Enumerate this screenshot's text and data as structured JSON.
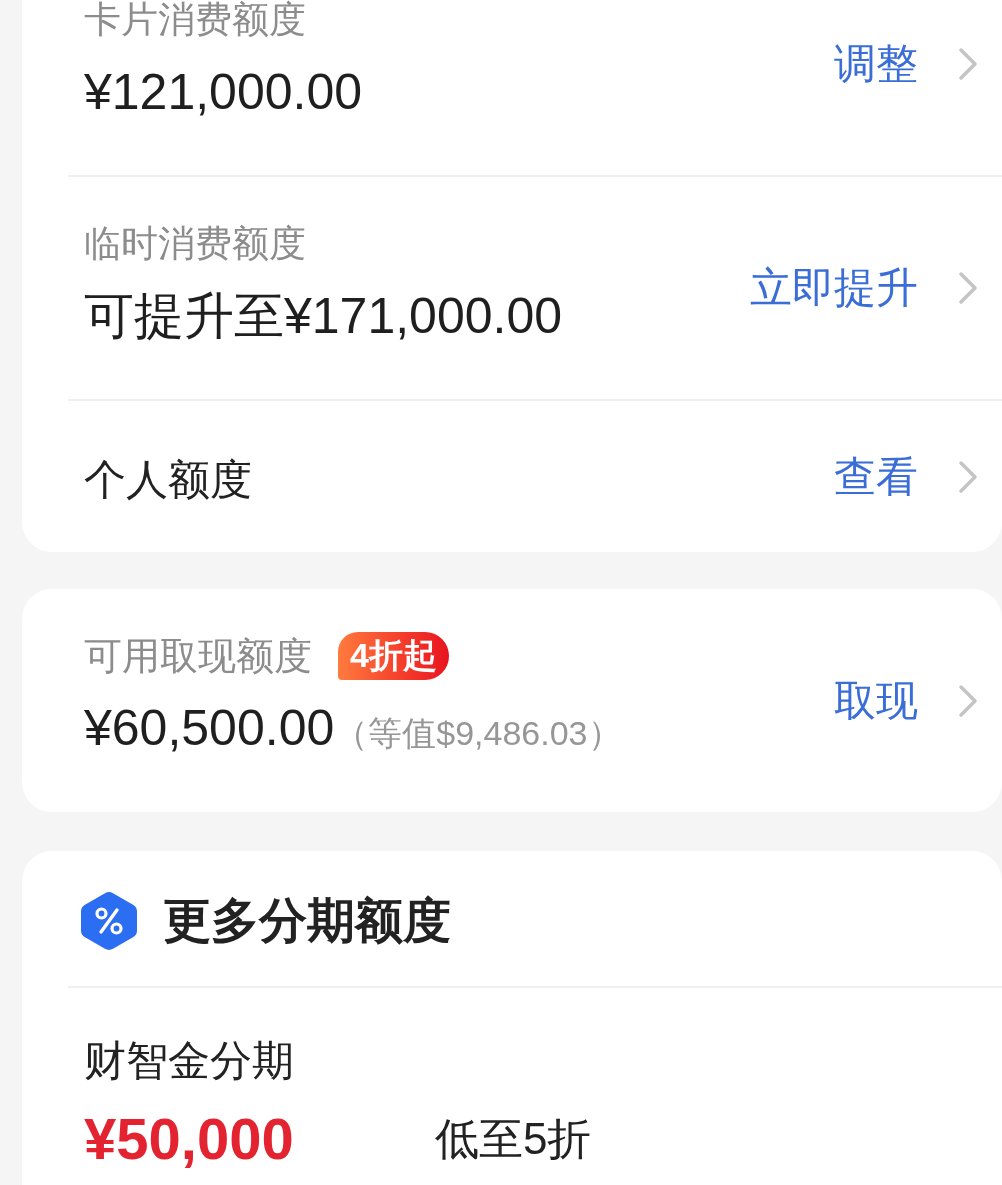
{
  "limit_card": {
    "rows": [
      {
        "kind": "amount",
        "label": "卡片消费额度",
        "value": "¥121,000.00",
        "action": "调整"
      },
      {
        "kind": "amount",
        "label": "临时消费额度",
        "value": "可提升至¥171,000.00",
        "action": "立即提升"
      },
      {
        "kind": "link",
        "label": "个人额度",
        "action": "查看"
      }
    ]
  },
  "cash_card": {
    "label": "可用取现额度",
    "badge": "4折起",
    "value": "¥60,500.00",
    "note": "（等值$9,486.03）",
    "action": "取现"
  },
  "installment_card": {
    "title": "更多分期额度",
    "items": [
      {
        "name": "财智金分期",
        "amount": "¥50,000",
        "discount": "低至5折"
      }
    ]
  }
}
